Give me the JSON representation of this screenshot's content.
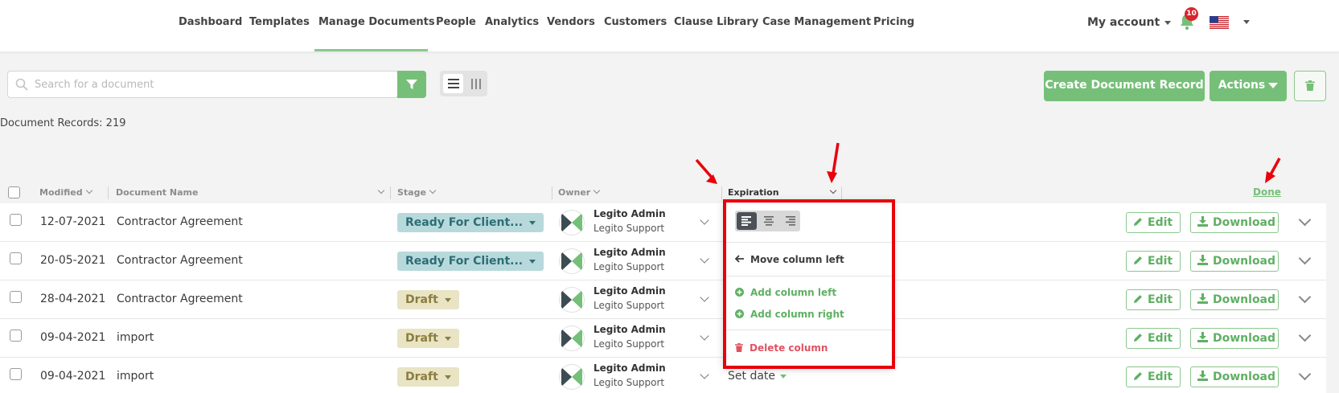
{
  "nav": {
    "items": [
      "Dashboard",
      "Templates",
      "Manage Documents",
      "People",
      "Analytics",
      "Vendors",
      "Customers",
      "Clause Library",
      "Case Management",
      "Pricing"
    ],
    "account_label": "My account",
    "notification_count": "10"
  },
  "toolbar": {
    "search_placeholder": "Search for a document",
    "create_label": "Create Document Record",
    "actions_label": "Actions"
  },
  "records_label": "Document Records: 219",
  "columns": {
    "modified": "Modified",
    "name": "Document Name",
    "stage": "Stage",
    "owner": "Owner",
    "expiration": "Expiration",
    "done": "Done"
  },
  "rows": [
    {
      "modified": "12-07-2021",
      "name": "Contractor Agreement",
      "stage": "Ready For Client...",
      "stage_type": "ready",
      "owner": "Legito Admin",
      "owner_sub": "Legito Support"
    },
    {
      "modified": "20-05-2021",
      "name": "Contractor Agreement",
      "stage": "Ready For Client...",
      "stage_type": "ready",
      "owner": "Legito Admin",
      "owner_sub": "Legito Support"
    },
    {
      "modified": "28-04-2021",
      "name": "Contractor Agreement",
      "stage": "Draft",
      "stage_type": "draft",
      "owner": "Legito Admin",
      "owner_sub": "Legito Support"
    },
    {
      "modified": "09-04-2021",
      "name": "import",
      "stage": "Draft",
      "stage_type": "draft",
      "owner": "Legito Admin",
      "owner_sub": "Legito Support"
    },
    {
      "modified": "09-04-2021",
      "name": "import",
      "stage": "Draft",
      "stage_type": "draft",
      "owner": "Legito Admin",
      "owner_sub": "Legito Support",
      "expiration": "Set date"
    }
  ],
  "row_actions": {
    "edit": "Edit",
    "download": "Download"
  },
  "column_menu": {
    "move_left": "Move column left",
    "add_left": "Add column left",
    "add_right": "Add column right",
    "delete": "Delete column"
  },
  "colors": {
    "brand_green": "#76bf79",
    "danger_red": "#e05262",
    "annotation_red": "#e8000b"
  }
}
